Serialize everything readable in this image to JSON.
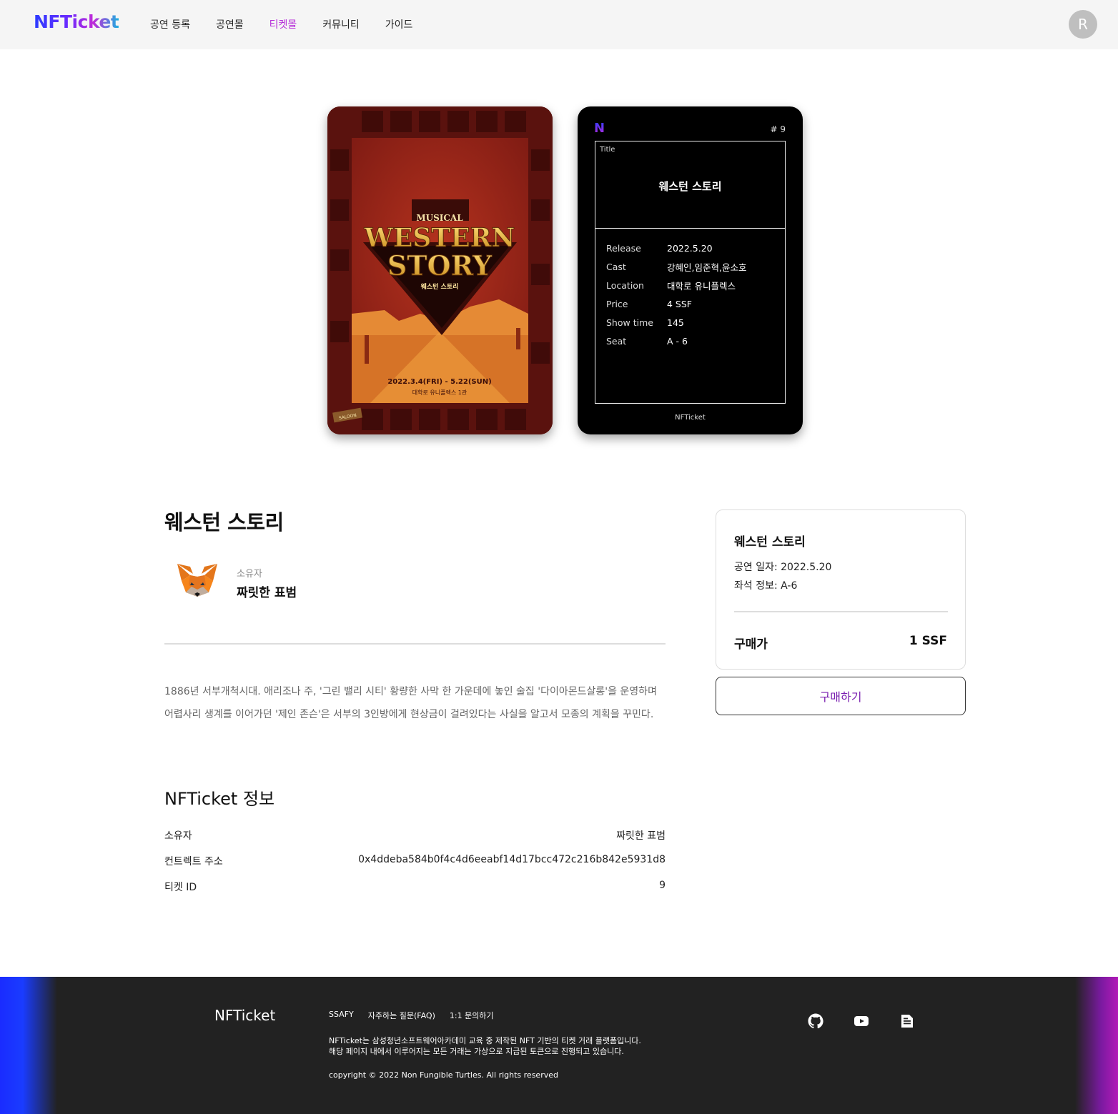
{
  "header": {
    "logo": "NFTicket",
    "nav": [
      "공연 등록",
      "공연몰",
      "티켓몰",
      "커뮤니티",
      "가이드"
    ],
    "active_nav": "티켓몰",
    "avatar_initial": "R"
  },
  "poster": {
    "musical_label": "MUSICAL",
    "title_line1": "WESTERN",
    "title_line2": "STORY",
    "korean_title": "웨스턴 스토리",
    "dates": "2022.3.4(FRI) - 5.22(SUN)",
    "venue": "대학로 유니플렉스 1관",
    "sign": "SALOON"
  },
  "ticket": {
    "logo_letter": "N",
    "number": "# 9",
    "title_label": "Title",
    "title": "웨스턴 스토리",
    "rows": [
      {
        "k": "Release",
        "v": "2022.5.20"
      },
      {
        "k": "Cast",
        "v": "강혜인,임준혁,윤소호"
      },
      {
        "k": "Location",
        "v": "대학로 유니플렉스"
      },
      {
        "k": "Price",
        "v": "4 SSF"
      },
      {
        "k": "Show time",
        "v": "145"
      },
      {
        "k": "Seat",
        "v": "A - 6"
      }
    ],
    "footer": "NFTicket"
  },
  "main": {
    "title": "웨스턴 스토리",
    "owner_label": "소유자",
    "owner_name": "짜릿한 표범",
    "description": "1886년 서부개척시대. 애리조나 주, '그린 밸리 시티' 황량한 사막 한 가운데에 놓인 술집 '다이아몬드살롱'을 운영하며 어렵사리 생계를 이어가던 '제인 존슨'은 서부의 3인방에게 현상금이 걸려있다는 사실을 알고서 모종의 계획을 꾸민다.",
    "section_title": "NFTicket 정보",
    "info": [
      {
        "k": "소유자",
        "v": "짜릿한 표범"
      },
      {
        "k": "컨트렉트 주소",
        "v": "0x4ddeba584b0f4c4d6eeabf14d17bcc472c216b842e5931d8"
      },
      {
        "k": "티켓 ID",
        "v": "9"
      }
    ]
  },
  "purchase": {
    "title": "웨스턴 스토리",
    "date_line": "공연 일자: 2022.5.20",
    "seat_line": "좌석 정보: A-6",
    "price_label": "구매가",
    "price": "1 SSF",
    "button": "구매하기"
  },
  "footer": {
    "logo": "NFTicket",
    "links": [
      "SSAFY",
      "자주하는 질문(FAQ)",
      "1:1 문의하기"
    ],
    "desc1": "NFTicket는 삼성청년소프트웨어아카데미 교육 중 제작된 NFT 기반의 티켓 거래 플랫폼입니다.",
    "desc2": "해당 페이지 내에서 이루어지는 모든 거래는 가상으로 지급된 토큰으로 진행되고 있습니다.",
    "copyright": "copyright © 2022 Non Fungible Turtles. All rights reserved",
    "icons": [
      "github-icon",
      "youtube-icon",
      "document-icon"
    ]
  },
  "colors": {
    "accent": "#b52bd8",
    "button_text": "#7a1fb0",
    "footer_bg": "#222222"
  }
}
